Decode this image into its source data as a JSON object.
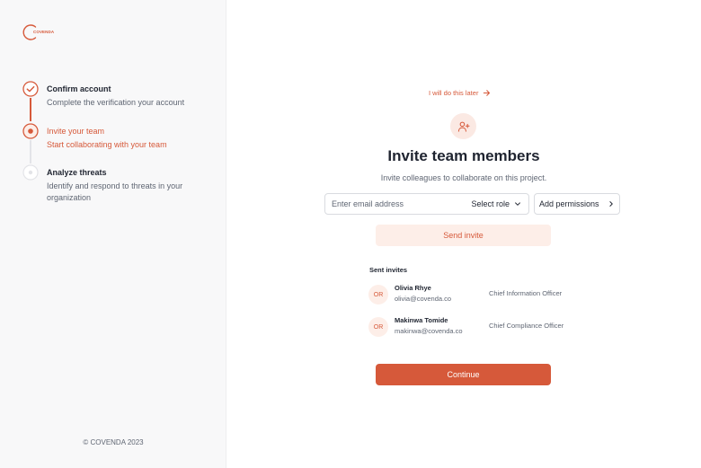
{
  "brand": {
    "name": "COVENDA",
    "accent": "#d6593a"
  },
  "steps": [
    {
      "title": "Confirm account",
      "description": "Complete the verification your account",
      "state": "completed"
    },
    {
      "title": "Invite your team",
      "description": "Start collaborating with your team",
      "state": "active"
    },
    {
      "title": "Analyze threats",
      "description": "Identify and respond to threats in your organization",
      "state": "upcoming"
    }
  ],
  "footer": {
    "copyright": "© COVENDA 2023"
  },
  "main": {
    "skip_label": "I will do this later",
    "title": "Invite team members",
    "subtitle": "Invite colleagues to collaborate on this project.",
    "email_placeholder": "Enter email address",
    "email_value": "",
    "role_label": "Select role",
    "permissions_label": "Add permissions",
    "send_label": "Send invite",
    "sent_heading": "Sent invites",
    "invites": [
      {
        "initials": "OR",
        "name": "Olivia Rhye",
        "email": "olivia@covenda.co",
        "role": "Chief Information Officer"
      },
      {
        "initials": "OR",
        "name": "Makinwa Tomide",
        "email": "makinwa@covenda.co",
        "role": "Chief Compliance Officer"
      }
    ],
    "continue_label": "Continue"
  },
  "icons": {
    "step_completed": "check-circle-icon",
    "step_active": "radio-dot-icon",
    "step_upcoming": "empty-circle-icon",
    "skip_arrow": "arrow-right-icon",
    "invite": "user-plus-icon",
    "role_dropdown": "chevron-down-icon",
    "permissions": "chevron-right-icon"
  }
}
